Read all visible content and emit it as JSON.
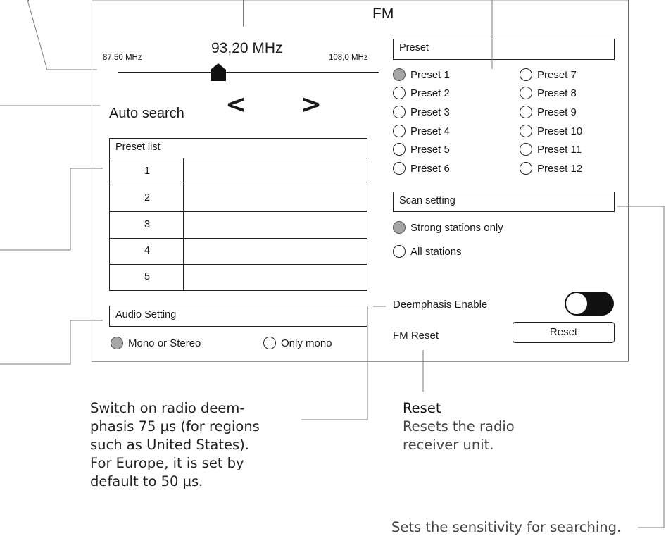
{
  "title": "FM",
  "tuner": {
    "frequency": "93,20 MHz",
    "min_label": "87,50 MHz",
    "max_label": "108,0 MHz",
    "position_fraction": 0.28
  },
  "auto_search": {
    "label": "Auto search",
    "prev_icon": "<",
    "next_icon": ">"
  },
  "preset_list": {
    "header": "Preset list",
    "rows": [
      "1",
      "2",
      "3",
      "4",
      "5"
    ]
  },
  "audio": {
    "header": "Audio Setting",
    "options": [
      {
        "label": "Mono or Stereo",
        "selected": true
      },
      {
        "label": "Only mono",
        "selected": false
      }
    ]
  },
  "preset": {
    "header": "Preset",
    "options": [
      {
        "label": "Preset 1",
        "selected": true
      },
      {
        "label": "Preset 2",
        "selected": false
      },
      {
        "label": "Preset 3",
        "selected": false
      },
      {
        "label": "Preset 4",
        "selected": false
      },
      {
        "label": "Preset 5",
        "selected": false
      },
      {
        "label": "Preset 6",
        "selected": false
      },
      {
        "label": "Preset 7",
        "selected": false
      },
      {
        "label": "Preset 8",
        "selected": false
      },
      {
        "label": "Preset 9",
        "selected": false
      },
      {
        "label": "Preset 10",
        "selected": false
      },
      {
        "label": "Preset 11",
        "selected": false
      },
      {
        "label": "Preset 12",
        "selected": false
      }
    ]
  },
  "scan": {
    "header": "Scan setting",
    "options": [
      {
        "label": "Strong stations only",
        "selected": true
      },
      {
        "label": "All stations",
        "selected": false
      }
    ]
  },
  "deemphasis": {
    "label": "Deemphasis Enable",
    "enabled": false
  },
  "fm_reset": {
    "label": "FM Reset",
    "button": "Reset"
  },
  "captions": {
    "deemphasis_lines": [
      "Switch on radio deem-",
      "phasis 75 µs (for regions",
      "such as United States).",
      "For Europe, it is set by",
      "default to 50 µs."
    ],
    "reset_title": "Reset",
    "reset_lines": [
      "Resets the radio",
      "receiver unit."
    ],
    "scan_text": "Sets the sensitivity for searching."
  },
  "colors": {
    "selected_radio": "#a6a6a6",
    "toggle_on_part": "#111111"
  }
}
